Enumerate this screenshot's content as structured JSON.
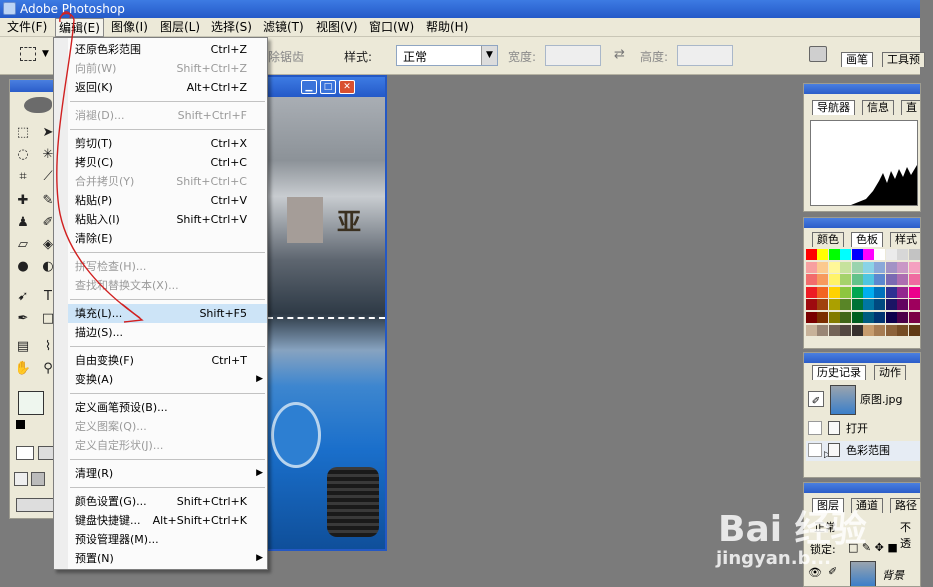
{
  "app": {
    "title": "Adobe Photoshop"
  },
  "menubar": {
    "items": [
      {
        "label": "文件(F)"
      },
      {
        "label": "编辑(E)",
        "active": true
      },
      {
        "label": "图像(I)"
      },
      {
        "label": "图层(L)"
      },
      {
        "label": "选择(S)"
      },
      {
        "label": "滤镜(T)"
      },
      {
        "label": "视图(V)"
      },
      {
        "label": "窗口(W)"
      },
      {
        "label": "帮助(H)"
      }
    ]
  },
  "options_bar": {
    "antialias_label": "除锯齿",
    "style_label": "样式:",
    "style_value": "正常",
    "width_label": "宽度:",
    "height_label": "高度:",
    "panel_tabs": [
      "画笔",
      "工具预"
    ]
  },
  "edit_menu": {
    "groups": [
      [
        {
          "label": "还原色彩范围",
          "shortcut": "Ctrl+Z",
          "disabled": false
        },
        {
          "label": "向前(W)",
          "shortcut": "Shift+Ctrl+Z",
          "disabled": true
        },
        {
          "label": "返回(K)",
          "shortcut": "Alt+Ctrl+Z",
          "disabled": false
        }
      ],
      [
        {
          "label": "消褪(D)...",
          "shortcut": "Shift+Ctrl+F",
          "disabled": true
        }
      ],
      [
        {
          "label": "剪切(T)",
          "shortcut": "Ctrl+X",
          "disabled": false
        },
        {
          "label": "拷贝(C)",
          "shortcut": "Ctrl+C",
          "disabled": false
        },
        {
          "label": "合并拷贝(Y)",
          "shortcut": "Shift+Ctrl+C",
          "disabled": true
        },
        {
          "label": "粘贴(P)",
          "shortcut": "Ctrl+V",
          "disabled": false
        },
        {
          "label": "粘贴入(I)",
          "shortcut": "Shift+Ctrl+V",
          "disabled": false
        },
        {
          "label": "清除(E)",
          "shortcut": "",
          "disabled": false
        }
      ],
      [
        {
          "label": "拼写检查(H)...",
          "shortcut": "",
          "disabled": true
        },
        {
          "label": "查找和替换文本(X)...",
          "shortcut": "",
          "disabled": true
        }
      ],
      [
        {
          "label": "填充(L)...",
          "shortcut": "Shift+F5",
          "disabled": false,
          "highlighted": true
        },
        {
          "label": "描边(S)...",
          "shortcut": "",
          "disabled": false
        }
      ],
      [
        {
          "label": "自由变换(F)",
          "shortcut": "Ctrl+T",
          "disabled": false
        },
        {
          "label": "变换(A)",
          "shortcut": "",
          "disabled": false,
          "submenu": true
        }
      ],
      [
        {
          "label": "定义画笔预设(B)...",
          "shortcut": "",
          "disabled": false
        },
        {
          "label": "定义图案(Q)...",
          "shortcut": "",
          "disabled": true
        },
        {
          "label": "定义自定形状(J)...",
          "shortcut": "",
          "disabled": true
        }
      ],
      [
        {
          "label": "清理(R)",
          "shortcut": "",
          "disabled": false,
          "submenu": true
        }
      ],
      [
        {
          "label": "颜色设置(G)...",
          "shortcut": "Shift+Ctrl+K",
          "disabled": false
        },
        {
          "label": "键盘快捷键...",
          "shortcut": "Alt+Shift+Ctrl+K",
          "disabled": false
        },
        {
          "label": "预设管理器(M)...",
          "shortcut": "",
          "disabled": false
        },
        {
          "label": "预置(N)",
          "shortcut": "",
          "disabled": false,
          "submenu": true
        }
      ]
    ]
  },
  "document": {
    "sign_text": "亚"
  },
  "panels": {
    "navigator_tabs": [
      "导航器",
      "信息",
      "直"
    ],
    "color_tabs": [
      "颜色",
      "色板",
      "样式"
    ],
    "history_tabs": [
      "历史记录",
      "动作"
    ],
    "history_snapshot": "原图.jpg",
    "history_items": [
      "打开",
      "色彩范围"
    ],
    "layers_tabs": [
      "图层",
      "通道",
      "路径"
    ],
    "layers_blend": "正常",
    "layers_opacity": "不透",
    "layers_lock_label": "锁定:",
    "layer_name": "背景"
  },
  "swatch_colors": [
    "#ff0000",
    "#ffff00",
    "#00ff00",
    "#00ffff",
    "#0000ff",
    "#ff00ff",
    "#ffffff",
    "#ebebeb",
    "#d7d7d7",
    "#c3c3c3",
    "#f7a0a0",
    "#fbc98f",
    "#fff799",
    "#c7e29d",
    "#9bd3ae",
    "#8ad3e7",
    "#8aa9d9",
    "#a293c5",
    "#c998c6",
    "#f4a0c0",
    "#f26c6c",
    "#f79a5e",
    "#fff36a",
    "#a5d26b",
    "#63c28a",
    "#4fc5e0",
    "#5b88cf",
    "#7b6ab2",
    "#ad6eb1",
    "#ef6ba0",
    "#ed1c24",
    "#f26522",
    "#ffd200",
    "#8dc63f",
    "#00a651",
    "#00aeef",
    "#0072bc",
    "#2e3192",
    "#92278f",
    "#ec008c",
    "#9e0b0f",
    "#a0410d",
    "#aba000",
    "#598527",
    "#007236",
    "#0076a3",
    "#004a80",
    "#1b1464",
    "#630460",
    "#9e005d",
    "#790000",
    "#7b2e00",
    "#827b00",
    "#406618",
    "#005e20",
    "#005b7f",
    "#003471",
    "#0d004c",
    "#4b0049",
    "#7b0046",
    "#c7b299",
    "#998675",
    "#736357",
    "#534741",
    "#37302d",
    "#c69c6d",
    "#a67c52",
    "#8c6239",
    "#754c24",
    "#603913"
  ],
  "watermark": {
    "logo": "Bai 经验",
    "url": "jingyan.b..."
  }
}
